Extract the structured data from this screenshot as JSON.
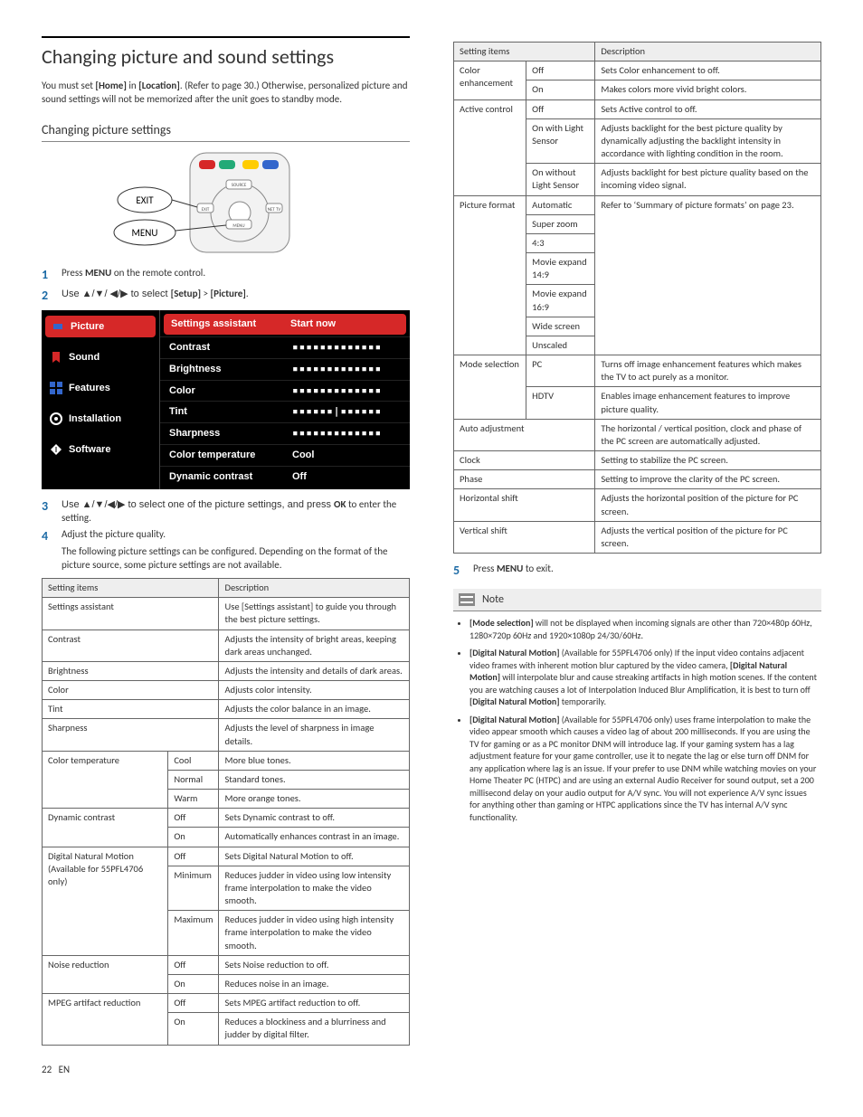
{
  "heading": "Changing picture and sound settings",
  "intro_a": "You must set ",
  "intro_b_bold": "[Home]",
  "intro_c": " in ",
  "intro_d_bold": "[Location]",
  "intro_e": ". (Refer to page 30.) Otherwise, personalized picture and sound settings will not be memorized after the unit goes to standby mode.",
  "subheading": "Changing picture settings",
  "remote_labels": {
    "exit": "EXIT",
    "menu": "MENU",
    "source": "SOURCE",
    "net": "NET TV"
  },
  "steps": {
    "s1_a": "Press ",
    "s1_b_bold": "MENU",
    "s1_c": " on the remote control.",
    "s2_a": "Use ▲/▼/ ◀/▶ to select ",
    "s2_b_bold": "[Setup]",
    "s2_c": " > ",
    "s2_d_bold": "[Picture]",
    "s2_e": ".",
    "s3_a": "Use ▲/▼/◀/▶ to select one of the picture settings, and press ",
    "s3_b_bold": "OK",
    "s3_c": " to enter the setting.",
    "s4": "Adjust the picture quality.",
    "s4_sub": "The following picture settings can be configured. Depending on the format of the picture source, some picture settings are not available.",
    "s5_a": "Press ",
    "s5_b_bold": "MENU",
    "s5_c": " to exit."
  },
  "osd": {
    "side": [
      "Picture",
      "Sound",
      "Features",
      "Installation",
      "Software"
    ],
    "rows": [
      {
        "label": "Settings assistant",
        "value": "Start now",
        "selected": true
      },
      {
        "label": "Contrast",
        "value_bars": true
      },
      {
        "label": "Brightness",
        "value_bars": true
      },
      {
        "label": "Color",
        "value_bars": true
      },
      {
        "label": "Tint",
        "value_bars": true,
        "center": true
      },
      {
        "label": "Sharpness",
        "value_bars": true
      },
      {
        "label": "Color temperature",
        "value": "Cool"
      },
      {
        "label": "Dynamic contrast",
        "value": "Off"
      }
    ]
  },
  "table1_head": {
    "c1": "Setting items",
    "c2": "Description"
  },
  "table1": [
    {
      "item": "Settings assistant",
      "opts": [],
      "descs": [
        "Use [Settings assistant] to guide you through the best picture settings."
      ]
    },
    {
      "item": "Contrast",
      "opts": [],
      "descs": [
        "Adjusts the intensity of bright areas, keeping dark areas unchanged."
      ]
    },
    {
      "item": "Brightness",
      "opts": [],
      "descs": [
        "Adjusts the intensity and details of dark areas."
      ]
    },
    {
      "item": "Color",
      "opts": [],
      "descs": [
        "Adjusts color intensity."
      ]
    },
    {
      "item": "Tint",
      "opts": [],
      "descs": [
        "Adjusts the color balance in an image."
      ]
    },
    {
      "item": "Sharpness",
      "opts": [],
      "descs": [
        "Adjusts the level of sharpness in image details."
      ]
    },
    {
      "item": "Color temperature",
      "opts": [
        "Cool",
        "Normal",
        "Warm"
      ],
      "descs": [
        "More blue tones.",
        "Standard tones.",
        "More orange tones."
      ]
    },
    {
      "item": "Dynamic contrast",
      "opts": [
        "Off",
        "On"
      ],
      "descs": [
        "Sets Dynamic contrast to off.",
        "Automatically enhances contrast in an image."
      ]
    },
    {
      "item": "Digital Natural Motion (Available for 55PFL4706 only)",
      "opts": [
        "Off",
        "Minimum",
        "Maximum"
      ],
      "descs": [
        "Sets Digital Natural Motion to off.",
        "Reduces judder in video using low intensity frame interpolation to make the video smooth.",
        "Reduces judder in video using high intensity frame interpolation to make the video smooth."
      ]
    },
    {
      "item": "Noise reduction",
      "opts": [
        "Off",
        "On"
      ],
      "descs": [
        "Sets Noise reduction to off.",
        "Reduces noise in an image."
      ]
    },
    {
      "item": "MPEG artifact reduction",
      "opts": [
        "Off",
        "On"
      ],
      "descs": [
        "Sets MPEG artifact reduction to off.",
        "Reduces a blockiness and a blurriness and judder by digital filter."
      ]
    }
  ],
  "table2_head": {
    "c1": "Setting items",
    "c2": "Description"
  },
  "table2": [
    {
      "item": "Color enhancement",
      "opts": [
        "Off",
        "On"
      ],
      "descs": [
        "Sets Color enhancement to off.",
        "Makes colors more vivid bright colors."
      ]
    },
    {
      "item": "Active control",
      "opts": [
        "Off",
        "On with Light Sensor",
        "On without Light Sensor"
      ],
      "descs": [
        "Sets Active control to off.",
        "Adjusts backlight for the best picture quality by dynamically adjusting the backlight intensity in accordance with lighting condition in the room.",
        "Adjusts backlight for best picture quality based on the incoming video signal."
      ]
    },
    {
      "item": "Picture format",
      "opts": [
        "Automatic",
        "Super zoom",
        "4:3",
        "Movie expand 14:9",
        "Movie expand 16:9",
        "Wide screen",
        "Unscaled"
      ],
      "descs_merged": "Refer to ‘Summary of picture formats’ on page 23."
    },
    {
      "item": "Mode selection",
      "opts": [
        "PC",
        "HDTV"
      ],
      "descs": [
        "Turns off image enhancement features which makes the TV to act purely as a monitor.",
        "Enables image enhancement features to improve picture quality."
      ]
    },
    {
      "item": "Auto adjustment",
      "opts": [],
      "descs": [
        "The horizontal / vertical position, clock and phase of the PC screen are automatically adjusted."
      ]
    },
    {
      "item": "Clock",
      "opts": [],
      "descs": [
        "Setting to stabilize the PC screen."
      ]
    },
    {
      "item": "Phase",
      "opts": [],
      "descs": [
        "Setting to improve the clarity of the PC screen."
      ]
    },
    {
      "item": "Horizontal shift",
      "opts": [],
      "descs": [
        "Adjusts the horizontal position of the picture for PC screen."
      ]
    },
    {
      "item": "Vertical shift",
      "opts": [],
      "descs": [
        "Adjusts the vertical position of the picture for PC screen."
      ]
    }
  ],
  "note_title": "Note",
  "notes": [
    "[Mode selection] will not be displayed when incoming signals are other than 720×480p 60Hz, 1280×720p 60Hz and 1920×1080p 24/30/60Hz.",
    "[Digital Natural Motion] (Available for 55PFL4706 only) If the input video contains adjacent video frames with inherent motion blur captured by the video camera, [Digital Natural Motion] will interpolate blur and cause streaking artifacts in high motion scenes. If the content you are watching causes a lot of Interpolation Induced Blur Amplification, it is best to turn off [Digital Natural Motion] temporarily.",
    "[Digital Natural Motion] (Available for 55PFL4706 only) uses frame interpolation to make the video appear smooth which causes a video lag of about 200 milliseconds. If you are using the TV for gaming or as a PC monitor DNM will introduce lag. If your gaming system has a lag adjustment feature for your game controller, use it to negate the lag or else turn off DNM for any application where lag is an issue. If your prefer to use DNM while watching movies on your Home Theater PC (HTPC) and are using an external Audio Receiver for sound output, set a 200 millisecond delay on your audio output for A/V sync. You will not experience A/V sync issues for anything other than gaming or HTPC applications since the TV has internal A/V sync functionality."
  ],
  "page_num": "22",
  "page_lang": "EN"
}
